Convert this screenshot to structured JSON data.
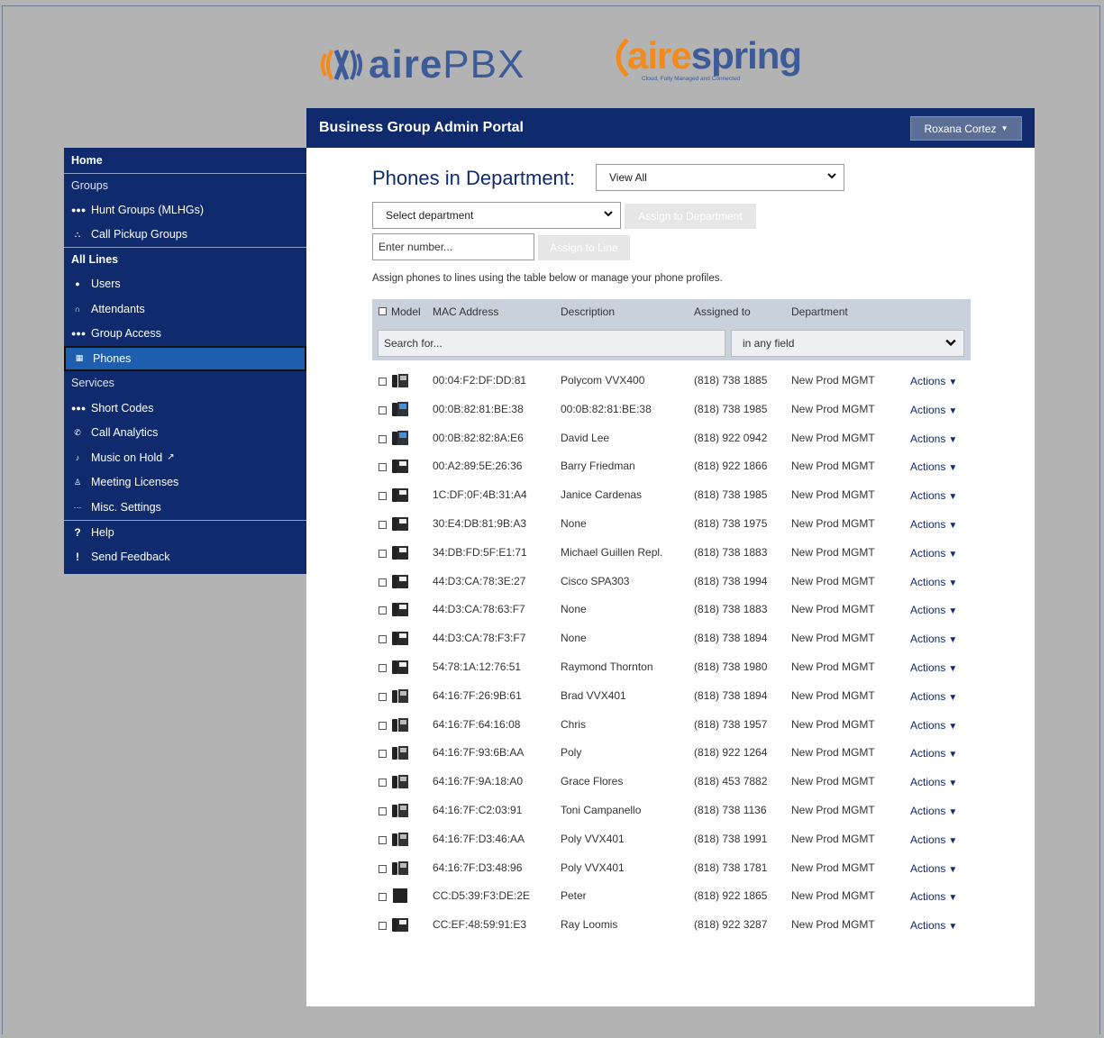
{
  "brand": {
    "aire_word": "aire",
    "aire_suffix": "PBX",
    "spring_a": "aire",
    "spring_rest": "spring",
    "spring_tagline": "Cloud, Fully Managed and Connected"
  },
  "header": {
    "title": "Business Group Admin Portal",
    "user_name": "Roxana Cortez"
  },
  "sidebar": {
    "home": "Home",
    "groups_label": "Groups",
    "groups": [
      {
        "label": "Hunt Groups (MLHGs)",
        "icon": "hunt-groups-icon"
      },
      {
        "label": "Call Pickup Groups",
        "icon": "call-pickup-icon"
      }
    ],
    "lines_label": "All Lines",
    "lines": [
      {
        "label": "Users",
        "icon": "user-icon"
      },
      {
        "label": "Attendants",
        "icon": "headset-icon"
      },
      {
        "label": "Group Access",
        "icon": "group-access-icon"
      },
      {
        "label": "Phones",
        "icon": "phone-icon"
      }
    ],
    "services_label": "Services",
    "services": [
      {
        "label": "Short Codes",
        "icon": "dots-icon"
      },
      {
        "label": "Call Analytics",
        "icon": "call-analytics-icon"
      },
      {
        "label": "Music on Hold",
        "icon": "music-icon"
      },
      {
        "label": "Meeting Licenses",
        "icon": "meeting-icon"
      },
      {
        "label": "Misc. Settings",
        "icon": "ellipsis-icon"
      }
    ],
    "help": "Help",
    "feedback": "Send Feedback"
  },
  "page": {
    "heading": "Phones in Department:",
    "view_select": "View All",
    "department_select": "Select department",
    "assign_dept_button": "Assign to Department",
    "number_placeholder": "Enter number...",
    "assign_line_button": "Assign to Line",
    "hint": "Assign phones to lines using the table below or manage your phone profiles."
  },
  "table": {
    "columns": {
      "model": "Model",
      "mac": "MAC Address",
      "desc": "Description",
      "assigned": "Assigned to",
      "dept": "Department"
    },
    "search_placeholder": "Search for...",
    "search_field": "in any field",
    "action_label": "Actions",
    "rows": [
      {
        "mac": "00:04:F2:DF:DD:81",
        "desc": "Polycom VVX400",
        "assigned": "(818) 738 1885",
        "dept": "New Prod MGMT",
        "model": "vvx"
      },
      {
        "mac": "00:0B:82:81:BE:38",
        "desc": "00:0B:82:81:BE:38",
        "assigned": "(818) 738 1985",
        "dept": "New Prod MGMT",
        "model": "gxp"
      },
      {
        "mac": "00:0B:82:82:8A:E6",
        "desc": "David Lee",
        "assigned": "(818) 922 0942",
        "dept": "New Prod MGMT",
        "model": "gxp"
      },
      {
        "mac": "00:A2:89:5E:26:36",
        "desc": "Barry Friedman",
        "assigned": "(818) 922 1866",
        "dept": "New Prod MGMT",
        "model": "spa"
      },
      {
        "mac": "1C:DF:0F:4B:31:A4",
        "desc": "Janice Cardenas",
        "assigned": "(818) 738 1985",
        "dept": "New Prod MGMT",
        "model": "spa"
      },
      {
        "mac": "30:E4:DB:81:9B:A3",
        "desc": "None",
        "assigned": "(818) 738 1975",
        "dept": "New Prod MGMT",
        "model": "spa"
      },
      {
        "mac": "34:DB:FD:5F:E1:71",
        "desc": "Michael Guillen Repl.",
        "assigned": "(818) 738 1883",
        "dept": "New Prod MGMT",
        "model": "spa"
      },
      {
        "mac": "44:D3:CA:78:3E:27",
        "desc": "Cisco SPA303",
        "assigned": "(818) 738 1994",
        "dept": "New Prod MGMT",
        "model": "spa"
      },
      {
        "mac": "44:D3:CA:78:63:F7",
        "desc": "None",
        "assigned": "(818) 738 1883",
        "dept": "New Prod MGMT",
        "model": "spa"
      },
      {
        "mac": "44:D3:CA:78:F3:F7",
        "desc": "None",
        "assigned": "(818) 738 1894",
        "dept": "New Prod MGMT",
        "model": "spa"
      },
      {
        "mac": "54:78:1A:12:76:51",
        "desc": "Raymond Thornton",
        "assigned": "(818) 738 1980",
        "dept": "New Prod MGMT",
        "model": "spa"
      },
      {
        "mac": "64:16:7F:26:9B:61",
        "desc": "Brad VVX401",
        "assigned": "(818) 738 1894",
        "dept": "New Prod MGMT",
        "model": "vvx"
      },
      {
        "mac": "64:16:7F:64:16:08",
        "desc": "Chris",
        "assigned": "(818) 738 1957",
        "dept": "New Prod MGMT",
        "model": "vvx"
      },
      {
        "mac": "64:16:7F:93:6B:AA",
        "desc": "Poly",
        "assigned": "(818) 922 1264",
        "dept": "New Prod MGMT",
        "model": "vvx"
      },
      {
        "mac": "64:16:7F:9A:18:A0",
        "desc": "Grace Flores",
        "assigned": "(818) 453 7882",
        "dept": "New Prod MGMT",
        "model": "vvx"
      },
      {
        "mac": "64:16:7F:C2:03:91",
        "desc": "Toni Campanello",
        "assigned": "(818) 738 1136",
        "dept": "New Prod MGMT",
        "model": "vvx"
      },
      {
        "mac": "64:16:7F:D3:46:AA",
        "desc": "Poly VVX401",
        "assigned": "(818) 738 1991",
        "dept": "New Prod MGMT",
        "model": "vvx"
      },
      {
        "mac": "64:16:7F:D3:48:96",
        "desc": "Poly VVX401",
        "assigned": "(818) 738 1781",
        "dept": "New Prod MGMT",
        "model": "vvx"
      },
      {
        "mac": "CC:D5:39:F3:DE:2E",
        "desc": "Peter",
        "assigned": "(818) 922 1865",
        "dept": "New Prod MGMT",
        "model": "dark"
      },
      {
        "mac": "CC:EF:48:59:91:E3",
        "desc": "Ray Loomis",
        "assigned": "(818) 922 3287",
        "dept": "New Prod MGMT",
        "model": "spa"
      }
    ]
  },
  "colors": {
    "navy": "#0f2b6e",
    "active": "#1d5fae",
    "background": "#b3b3b3",
    "accent_orange": "#f28a1e"
  }
}
